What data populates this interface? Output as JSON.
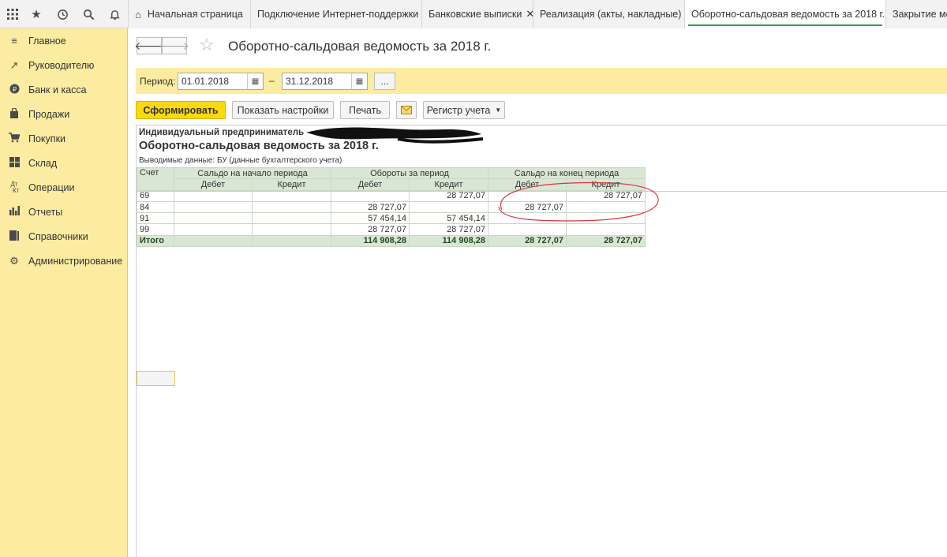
{
  "tabs": [
    {
      "label": "Начальная страница",
      "closable": false
    },
    {
      "label": "Подключение Интернет-поддержки",
      "closable": true
    },
    {
      "label": "Банковские выписки",
      "closable": true
    },
    {
      "label": "Реализация (акты, накладные)",
      "closable": true
    },
    {
      "label": "Оборотно-сальдовая ведомость за 2018 г.",
      "closable": true,
      "active": true
    },
    {
      "label": "Закрытие месяца",
      "closable": false
    }
  ],
  "sidebar": {
    "items": [
      {
        "label": "Главное",
        "icon": "menu-lines-icon"
      },
      {
        "label": "Руководителю",
        "icon": "trend-icon"
      },
      {
        "label": "Банк и касса",
        "icon": "ruble-coin-icon"
      },
      {
        "label": "Продажи",
        "icon": "bag-icon"
      },
      {
        "label": "Покупки",
        "icon": "cart-icon"
      },
      {
        "label": "Склад",
        "icon": "grid-icon"
      },
      {
        "label": "Операции",
        "icon": "dt-kt-icon"
      },
      {
        "label": "Отчеты",
        "icon": "bar-chart-icon"
      },
      {
        "label": "Справочники",
        "icon": "books-icon"
      },
      {
        "label": "Администрирование",
        "icon": "gear-icon"
      }
    ]
  },
  "page": {
    "title": "Оборотно-сальдовая ведомость за 2018 г."
  },
  "period": {
    "label": "Период:",
    "from": "01.01.2018",
    "separator": "–",
    "to": "31.12.2018",
    "more": "..."
  },
  "toolbar": {
    "generate": "Сформировать",
    "settings": "Показать настройки",
    "print": "Печать",
    "register": "Регистр учета"
  },
  "report": {
    "org": "Индивидуальный предприниматель",
    "title": "Оборотно-сальдовая ведомость за 2018 г.",
    "filter": "Выводимые данные:  БУ (данные бухгалтерского учета)",
    "headers": {
      "account": "Счет",
      "opening": "Сальдо на начало периода",
      "turnover": "Обороты за период",
      "closing": "Сальдо на конец периода",
      "debit": "Дебет",
      "credit": "Кредит"
    },
    "rows": [
      {
        "account": "69",
        "values": [
          "",
          "",
          "",
          "28 727,07",
          "",
          "28 727,07"
        ]
      },
      {
        "account": "84",
        "values": [
          "",
          "",
          "28 727,07",
          "",
          "28 727,07",
          ""
        ]
      },
      {
        "account": "91",
        "values": [
          "",
          "",
          "57 454,14",
          "57 454,14",
          "",
          ""
        ]
      },
      {
        "account": "99",
        "values": [
          "",
          "",
          "28 727,07",
          "28 727,07",
          "",
          ""
        ]
      }
    ],
    "total": {
      "account": "Итого",
      "values": [
        "",
        "",
        "114 908,28",
        "114 908,28",
        "28 727,07",
        "28 727,07"
      ]
    }
  }
}
